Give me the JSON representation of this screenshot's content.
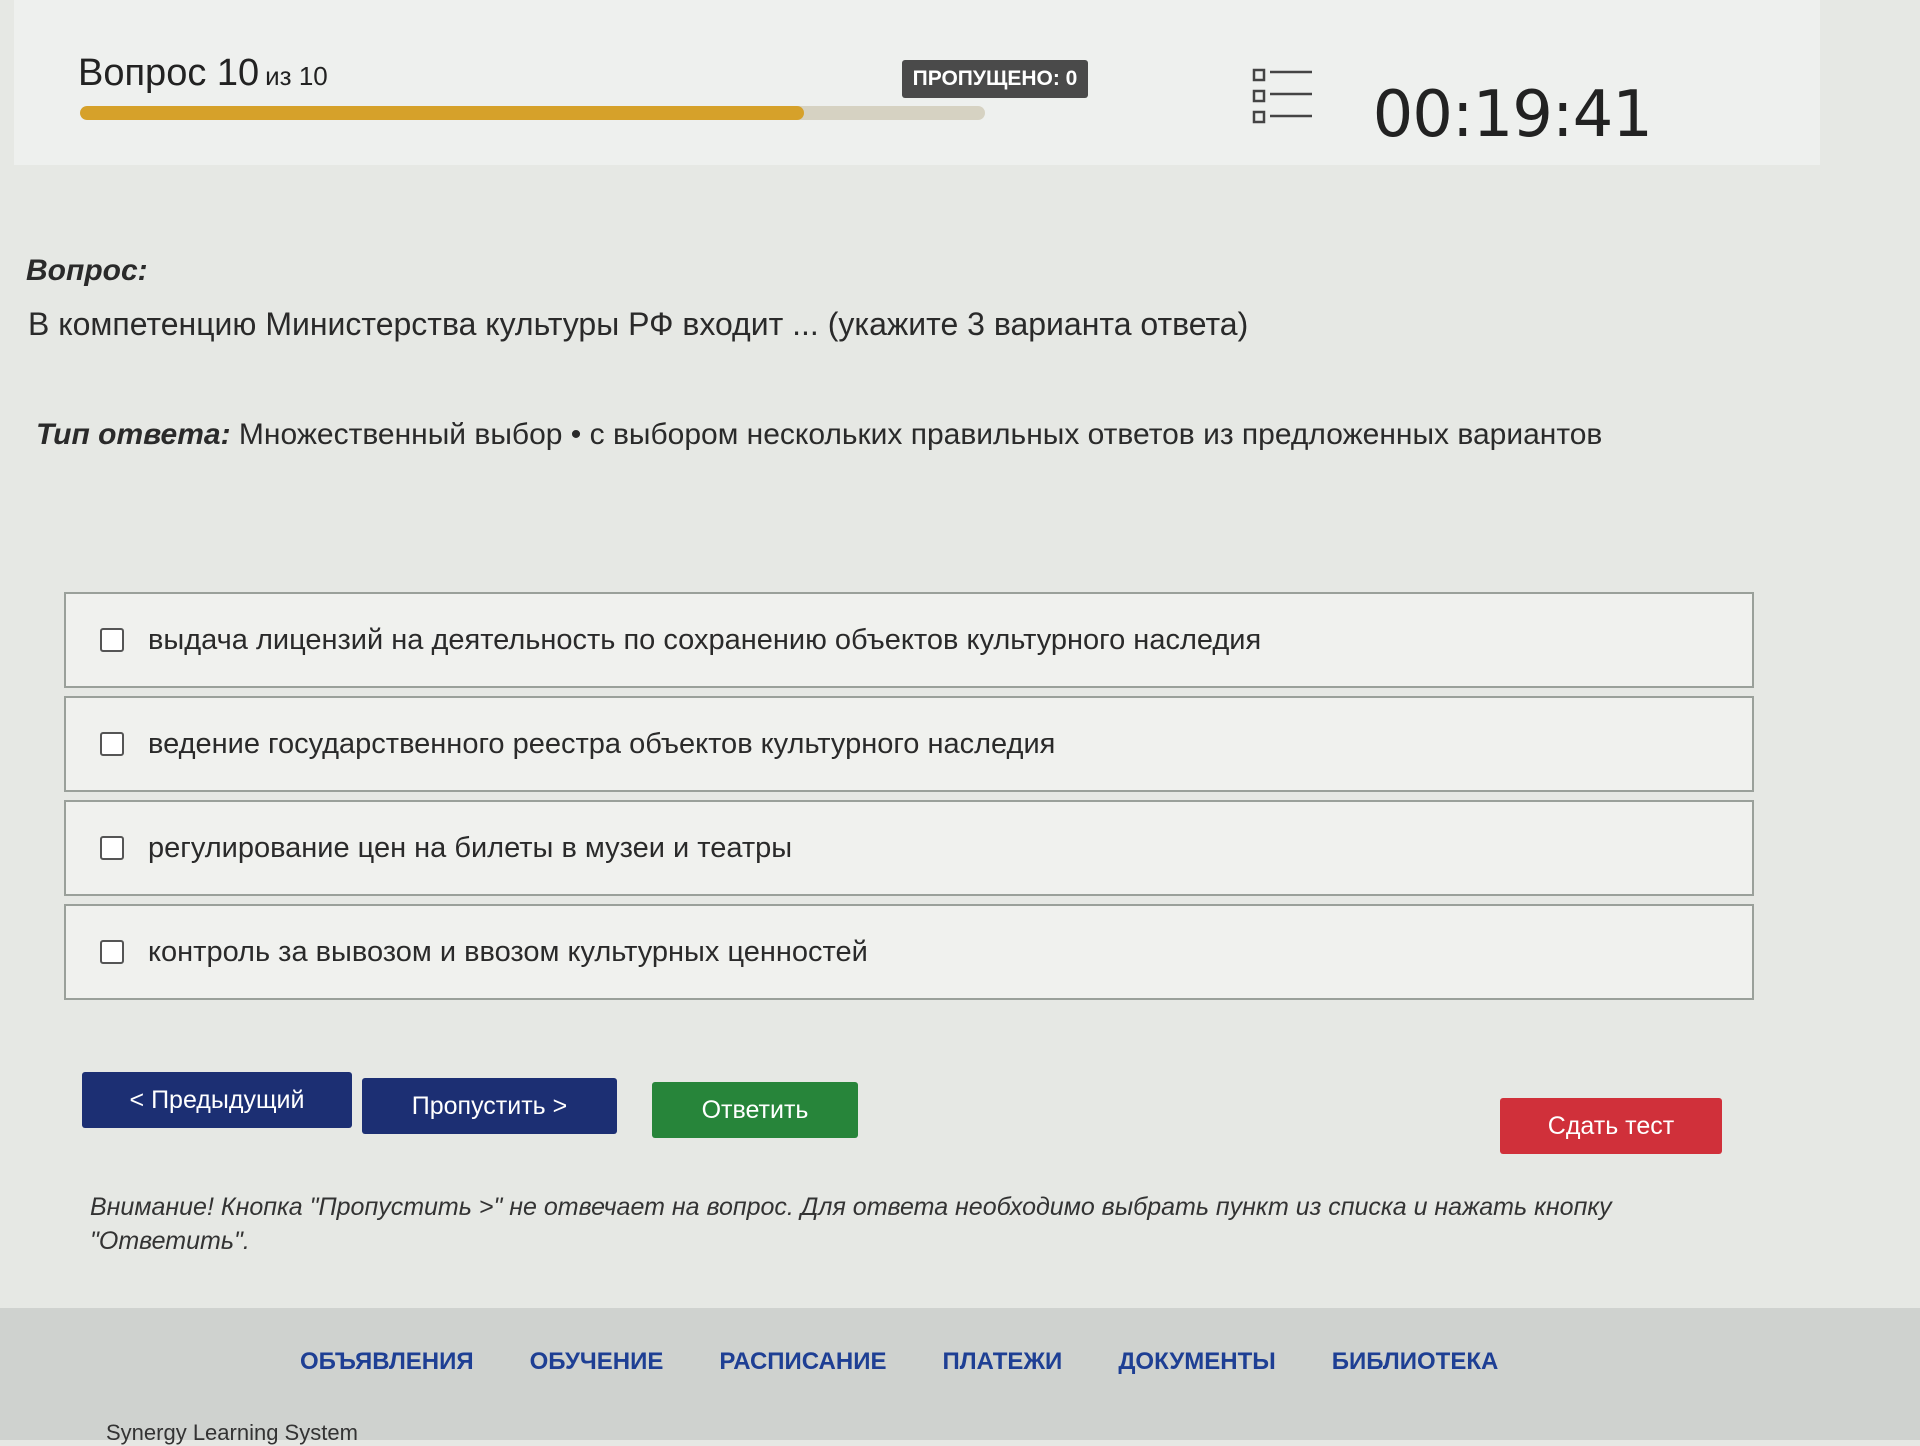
{
  "header": {
    "question_label": "Вопрос 10",
    "question_of": "из 10",
    "progress_fraction": 0.8,
    "skipped_label": "ПРОПУЩЕНО: 0",
    "list_icon": "list-icon",
    "timer": "00:19:41",
    "progress_color": "#d6a12a"
  },
  "question": {
    "label": "Вопрос:",
    "text": "В компетенцию Министерства культуры РФ входит ... (укажите 3 варианта ответа)"
  },
  "answer_type": {
    "label": "Тип ответа:",
    "text": "Множественный выбор • с выбором нескольких правильных ответов из предложенных вариантов"
  },
  "options": [
    "выдача лицензий на деятельность по сохранению объектов культурного наследия",
    "ведение государственного реестра объектов культурного наследия",
    "регулирование цен на билеты в музеи и театры",
    "контроль за вывозом и ввозом культурных ценностей"
  ],
  "buttons": {
    "prev": "< Предыдущий",
    "skip": "Пропустить >",
    "answer": "Ответить",
    "submit": "Сдать тест"
  },
  "warning": "Внимание! Кнопка \"Пропустить >\" не отвечает на вопрос. Для ответа необходимо выбрать пункт из списка и нажать кнопку \"Ответить\".",
  "footer": {
    "nav": [
      "ОБЪЯВЛЕНИЯ",
      "ОБУЧЕНИЕ",
      "РАСПИСАНИЕ",
      "ПЛАТЕЖИ",
      "ДОКУМЕНТЫ",
      "БИБЛИОТЕКА"
    ],
    "brand": "Synergy Learning System"
  },
  "colors": {
    "primary_button": "#1c2f73",
    "answer_button": "#27853a",
    "submit_button": "#d0303a",
    "nav_link": "#1e3f94"
  }
}
